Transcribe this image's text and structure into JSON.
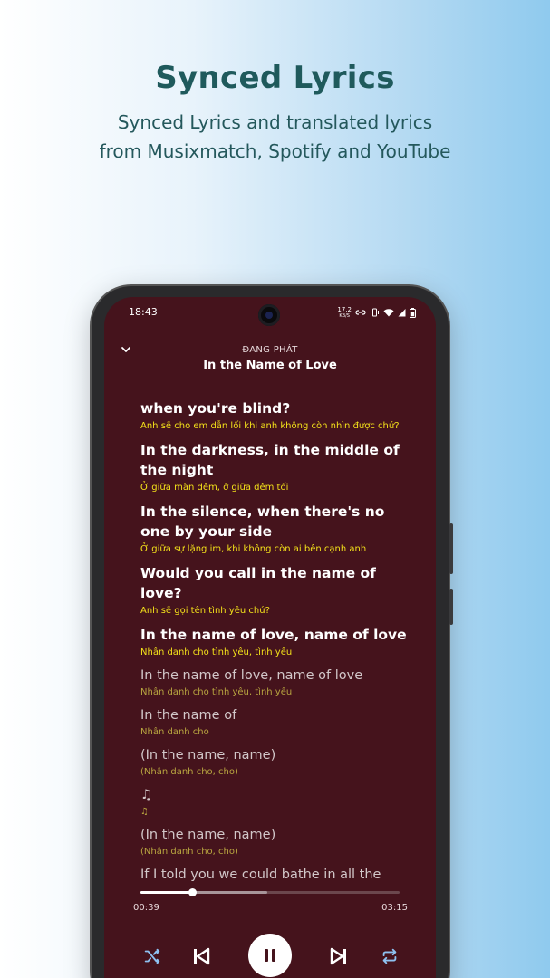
{
  "promo": {
    "title": "Synced Lyrics",
    "subtitle_line1": "Synced Lyrics and translated lyrics",
    "subtitle_line2": "from Musixmatch, Spotify and YouTube"
  },
  "status_bar": {
    "time": "18:43",
    "speed": "17.2",
    "speed_unit": "KB/S"
  },
  "header": {
    "now_playing_label": "ĐANG PHÁT",
    "song_title": "In the Name of Love"
  },
  "lyrics": [
    {
      "line": "when you're blind?",
      "translation": "Anh sẽ cho em dẫn lối khi anh không còn nhìn được chứ?",
      "state": "active"
    },
    {
      "line": "In the darkness, in the middle of the night",
      "translation": "Ở giữa màn đêm, ở giữa đêm tối",
      "state": "active"
    },
    {
      "line": "In the silence, when there's no one by your side",
      "translation": "Ở giữa sự lặng im, khi không còn ai bên cạnh anh",
      "state": "active"
    },
    {
      "line": "Would you call in the name of love?",
      "translation": "Anh sẽ gọi tên tình yêu chứ?",
      "state": "active"
    },
    {
      "line": "In the name of love, name of love",
      "translation": "Nhân danh cho tình yêu, tình yêu",
      "state": "active"
    },
    {
      "line": "In the name of love, name of love",
      "translation": "Nhân danh cho tình yêu, tình yêu",
      "state": "dim"
    },
    {
      "line": "In the name of",
      "translation": "Nhân danh cho",
      "state": "dim"
    },
    {
      "line": "(In the name, name)",
      "translation": "(Nhân danh cho, cho)",
      "state": "dim"
    },
    {
      "line": "♫",
      "translation": "♫",
      "state": "dim"
    },
    {
      "line": "(In the name, name)",
      "translation": "(Nhân danh cho, cho)",
      "state": "dim"
    },
    {
      "line": "If I told you we could bathe in all the",
      "translation": "",
      "state": "dim"
    }
  ],
  "player": {
    "elapsed": "00:39",
    "total": "03:15",
    "progress_fraction": 0.2,
    "buffered_fraction": 0.49
  },
  "icons": {
    "collapse": "chevron-down-icon",
    "shuffle": "shuffle-icon",
    "previous": "skip-previous-icon",
    "pause": "pause-icon",
    "next": "skip-next-icon",
    "repeat": "repeat-icon"
  },
  "colors": {
    "background": "#45131c",
    "translation": "#f4e21a",
    "accent_icon": "#8ec1f0"
  }
}
